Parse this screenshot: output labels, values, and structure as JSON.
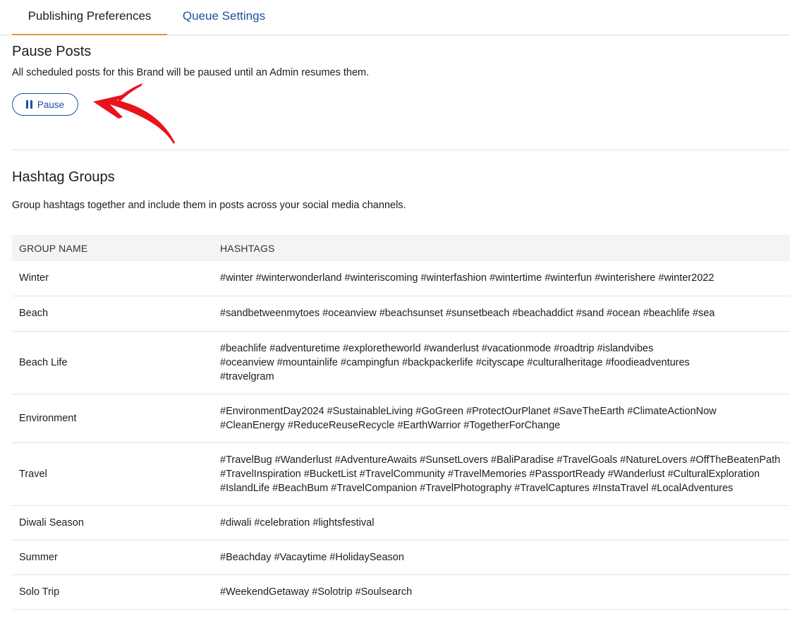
{
  "tabs": [
    {
      "label": "Publishing Preferences",
      "active": true
    },
    {
      "label": "Queue Settings",
      "active": false
    }
  ],
  "pause_section": {
    "title": "Pause Posts",
    "description": "All scheduled posts for this Brand will be paused until an Admin resumes them.",
    "button_label": "Pause",
    "button_icon": "pause-icon",
    "annotation_icon": "red-arrow-icon"
  },
  "hashtag_section": {
    "title": "Hashtag Groups",
    "description": "Group hashtags together and include them in posts across your social media channels.",
    "columns": [
      "GROUP NAME",
      "HASHTAGS"
    ],
    "rows": [
      {
        "name": "Winter",
        "hashtags": [
          "#winter #winterwonderland #winteriscoming #winterfashion #wintertime #winterfun #winterishere #winter2022"
        ]
      },
      {
        "name": "Beach",
        "hashtags": [
          "#sandbetweenmytoes #oceanview #beachsunset #sunsetbeach #beachaddict #sand #ocean #beachlife #sea"
        ]
      },
      {
        "name": "Beach Life",
        "hashtags": [
          "#beachlife #adventuretime #exploretheworld #wanderlust #vacationmode #roadtrip #islandvibes",
          "#oceanview #mountainlife #campingfun #backpackerlife #cityscape #culturalheritage #foodieadventures",
          "#travelgram"
        ]
      },
      {
        "name": "Environment",
        "hashtags": [
          "#EnvironmentDay2024 #SustainableLiving #GoGreen #ProtectOurPlanet #SaveTheEarth #ClimateActionNow",
          "#CleanEnergy #ReduceReuseRecycle #EarthWarrior #TogetherForChange"
        ]
      },
      {
        "name": "Travel",
        "hashtags": [
          "#TravelBug #Wanderlust #AdventureAwaits #SunsetLovers #BaliParadise #TravelGoals #NatureLovers #OffTheBeatenPath",
          "#TravelInspiration #BucketList #TravelCommunity #TravelMemories #PassportReady #Wanderlust #CulturalExploration",
          "#IslandLife #BeachBum #TravelCompanion #TravelPhotography #TravelCaptures #InstaTravel #LocalAdventures"
        ]
      },
      {
        "name": "Diwali Season",
        "hashtags": [
          "#diwali #celebration #lightsfestival"
        ]
      },
      {
        "name": "Summer",
        "hashtags": [
          "#Beachday #Vacaytime #HolidaySeason"
        ]
      },
      {
        "name": "Solo Trip",
        "hashtags": [
          "#WeekendGetaway #Solotrip #Soulsearch"
        ]
      }
    ]
  },
  "colors": {
    "accent_tab_underline": "#e3943b",
    "link_blue": "#1f4fa0",
    "annotation_red": "#e8141b"
  }
}
